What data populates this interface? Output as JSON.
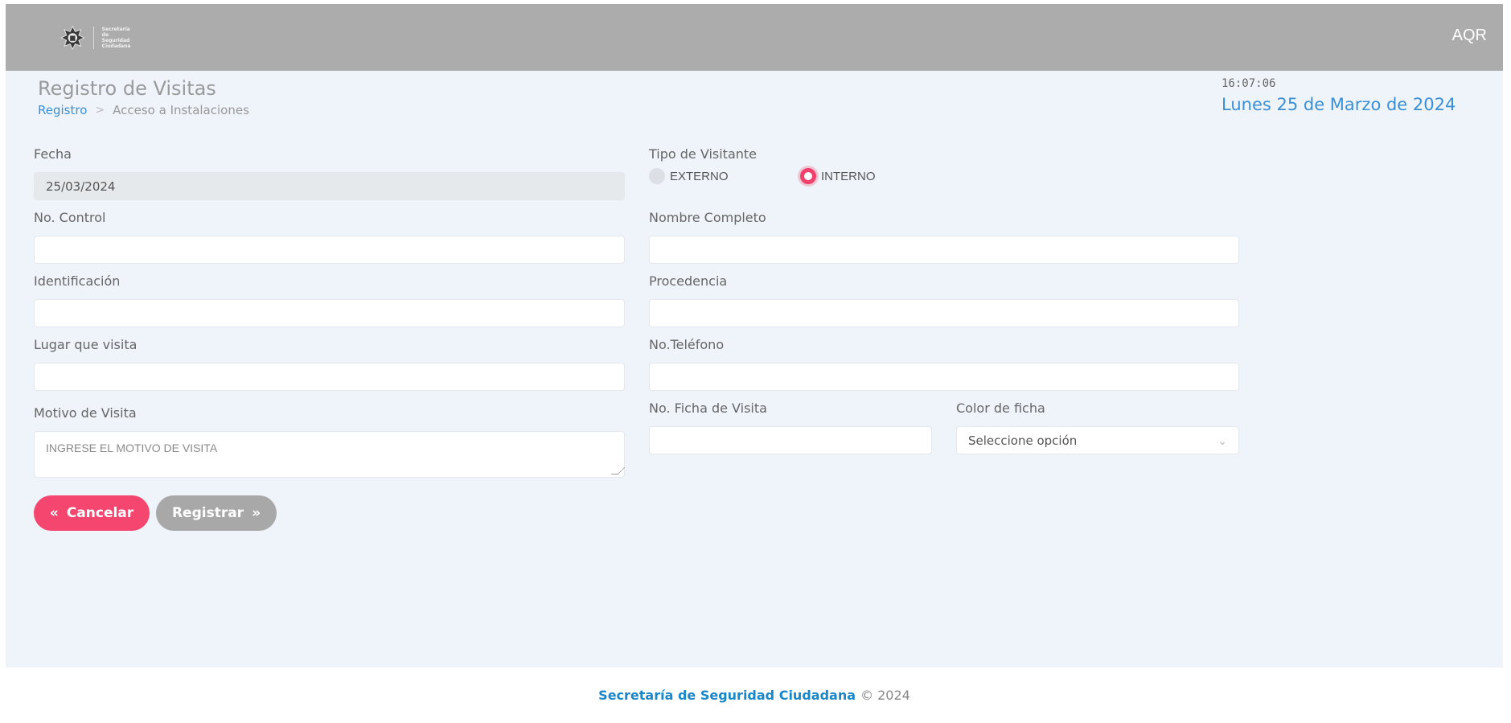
{
  "header": {
    "logo_text": "Secretaría de Seguridad Ciudadana",
    "user": "AQR"
  },
  "page": {
    "title": "Registro de Visitas",
    "breadcrumb": [
      "Registro",
      "Acceso a Instalaciones"
    ],
    "time": "16:07:06",
    "date": "Lunes 25 de Marzo de 2024"
  },
  "form": {
    "fecha": {
      "label": "Fecha",
      "value": "25/03/2024"
    },
    "tipo_visitante": {
      "label": "Tipo de Visitante",
      "options": [
        "EXTERNO",
        "INTERNO"
      ],
      "selected": "INTERNO"
    },
    "no_control": {
      "label": "No. Control",
      "value": ""
    },
    "nombre_completo": {
      "label": "Nombre Completo",
      "value": ""
    },
    "identificacion": {
      "label": "Identificación",
      "value": ""
    },
    "procedencia": {
      "label": "Procedencia",
      "value": ""
    },
    "lugar_visita": {
      "label": "Lugar que visita",
      "value": ""
    },
    "telefono": {
      "label": "No.Teléfono",
      "value": ""
    },
    "motivo": {
      "label": "Motivo de Visita",
      "placeholder": "INGRESE EL MOTIVO DE VISITA"
    },
    "ficha": {
      "label": "No. Ficha de Visita",
      "value": ""
    },
    "color_ficha": {
      "label": "Color de ficha",
      "selected": "Seleccione opción"
    }
  },
  "buttons": {
    "cancel": "Cancelar",
    "cancel_icon": "«",
    "register": "Registrar",
    "register_icon": "»"
  },
  "footer": {
    "org": "Secretaría de Seguridad Ciudadana",
    "copyright": "© 2024"
  },
  "colors": {
    "accent": "#f4466e",
    "link": "#3a8fd6",
    "topbar": "#acacac",
    "background": "#eef4f9"
  }
}
